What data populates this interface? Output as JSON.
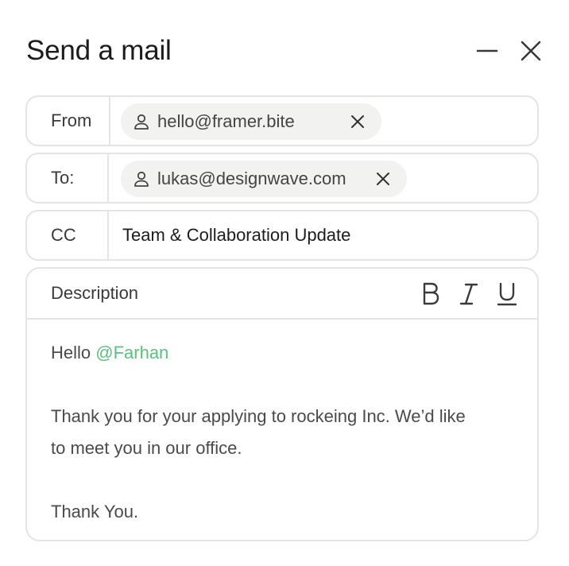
{
  "header": {
    "title": "Send a mail",
    "minimize_icon": "minus-icon",
    "close_icon": "x-icon"
  },
  "from": {
    "label": "From",
    "email": "hello@framer.bite",
    "icon": "user-icon"
  },
  "to": {
    "label": "To:",
    "email": "lukas@designwave.com",
    "icon": "user-icon"
  },
  "cc": {
    "label": "CC",
    "value": "Team & Collaboration Update"
  },
  "description": {
    "label": "Description",
    "format_buttons": [
      "bold-icon",
      "italic-icon",
      "underline-icon"
    ],
    "greeting": "Hello ",
    "mention": "@Farhan",
    "body_line_1": "Thank you for your  applying to rockeing Inc. We’d like",
    "body_line_2": "to meet you in our office.",
    "signoff": "Thank You.",
    "mention_color": "#5bbf7e"
  }
}
